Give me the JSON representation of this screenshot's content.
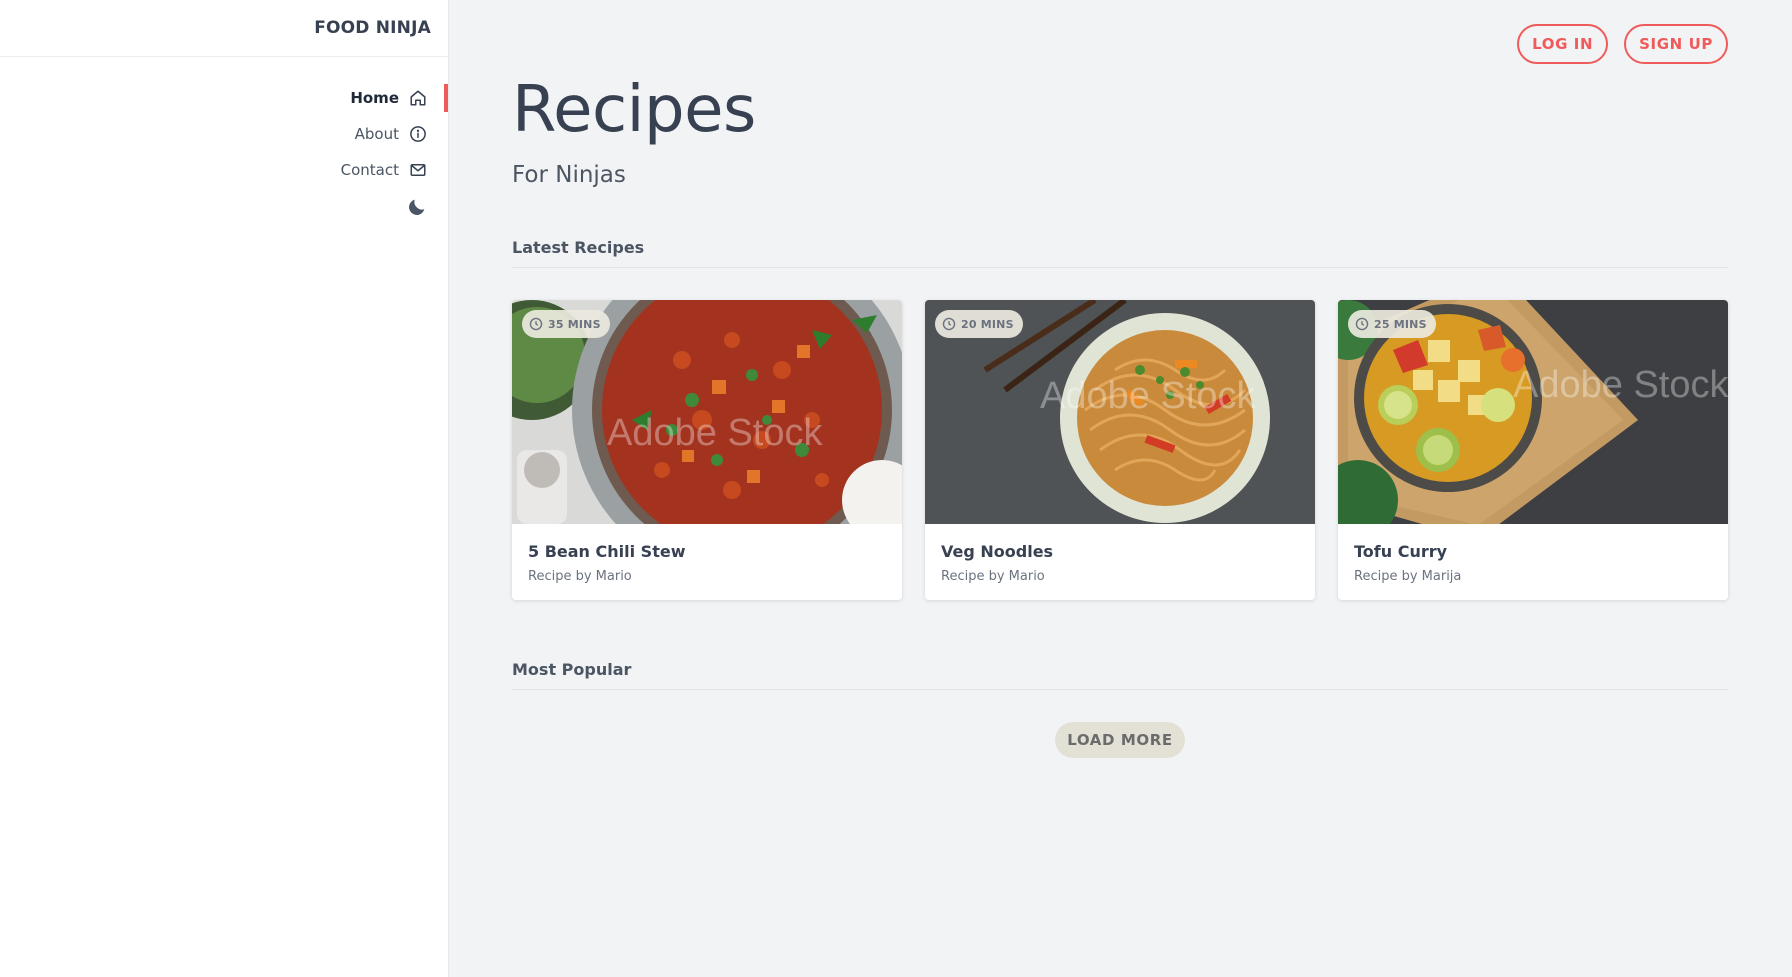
{
  "brand": "FOOD NINJA",
  "nav": {
    "items": [
      {
        "label": "Home",
        "icon": "home-icon",
        "active": true
      },
      {
        "label": "About",
        "icon": "info-icon",
        "active": false
      },
      {
        "label": "Contact",
        "icon": "mail-icon",
        "active": false
      }
    ],
    "theme_toggle_icon": "moon-icon"
  },
  "auth": {
    "login_label": "LOG IN",
    "signup_label": "SIGN UP"
  },
  "hero": {
    "title": "Recipes",
    "subtitle": "For Ninjas"
  },
  "latest": {
    "title": "Latest Recipes",
    "recipes": [
      {
        "time": "35 MINS",
        "title": "5 Bean Chili Stew",
        "author": "Recipe by Mario",
        "watermark": "Adobe Stock"
      },
      {
        "time": "20 MINS",
        "title": "Veg Noodles",
        "author": "Recipe by Mario",
        "watermark": "Adobe Stock"
      },
      {
        "time": "25 MINS",
        "title": "Tofu Curry",
        "author": "Recipe by Marija",
        "watermark": "Adobe Stock"
      }
    ]
  },
  "popular": {
    "title": "Most Popular",
    "load_more_label": "LOAD MORE"
  },
  "colors": {
    "accent": "#ef5a5a",
    "background": "#f2f3f5",
    "text": "#374151"
  }
}
